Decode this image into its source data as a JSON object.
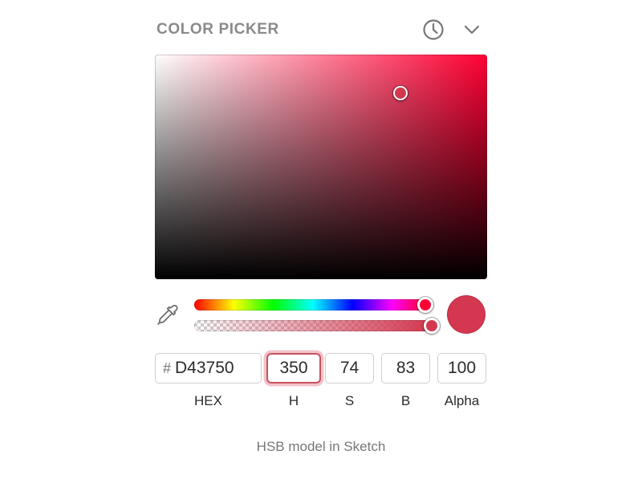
{
  "panel": {
    "title": "COLOR PICKER",
    "history_icon": "clock-icon",
    "collapse_icon": "chevron-down-icon"
  },
  "color": {
    "hex": "D43750",
    "hue": 350,
    "saturation": 74,
    "brightness": 83,
    "alpha": 100,
    "hue_color": "#ff0033",
    "swatch_color": "#D43750"
  },
  "sb_field": {
    "cursor_saturation": 0.74,
    "cursor_brightness": 0.83
  },
  "hue_slider": {
    "value_fraction": 0.972
  },
  "alpha_slider": {
    "value_fraction": 1.0
  },
  "eyedropper": {
    "icon": "eyedropper-icon"
  },
  "fields": {
    "hex": {
      "prefix": "#",
      "value": "D43750",
      "label": "HEX"
    },
    "h": {
      "value": "350",
      "label": "H"
    },
    "s": {
      "value": "74",
      "label": "S"
    },
    "b": {
      "value": "83",
      "label": "B"
    },
    "alpha": {
      "value": "100",
      "label": "Alpha"
    }
  },
  "caption": "HSB model in Sketch"
}
